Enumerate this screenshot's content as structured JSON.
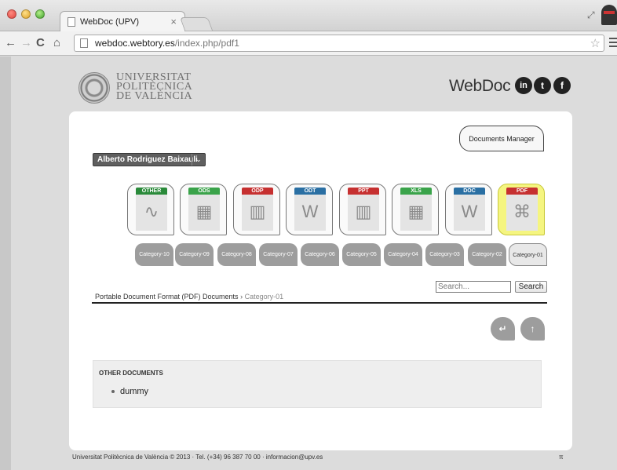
{
  "browser": {
    "tab_title": "WebDoc (UPV)",
    "tab_close": "×",
    "url_host": "webdoc.webtory.es",
    "url_path": "/index.php/pdf1",
    "back": "←",
    "forward": "→",
    "reload": "C",
    "home": "⌂",
    "star": "☆"
  },
  "header": {
    "university_lines": [
      "UNIVERSITAT",
      "POLITÈCNICA",
      "DE VALÈNCIA"
    ],
    "brand": "WebDoc",
    "social": {
      "linkedin": "in",
      "twitter": "t",
      "facebook": "f"
    }
  },
  "documents_manager_label": "Documents Manager",
  "user": {
    "name": "Alberto Rodriguez Baixauli",
    "caret": "⌄"
  },
  "types": [
    {
      "label": "OTHER",
      "color": "#2a8a3a",
      "glyph": "∿"
    },
    {
      "label": "ODS",
      "color": "#3aa34a",
      "glyph": "▦"
    },
    {
      "label": "ODP",
      "color": "#c63030",
      "glyph": "▥"
    },
    {
      "label": "ODT",
      "color": "#2a6fa3",
      "glyph": "W"
    },
    {
      "label": "PPT",
      "color": "#c63030",
      "glyph": "▥"
    },
    {
      "label": "XLS",
      "color": "#3aa34a",
      "glyph": "▦"
    },
    {
      "label": "DOC",
      "color": "#2a6fa3",
      "glyph": "W"
    },
    {
      "label": "PDF",
      "color": "#c63030",
      "glyph": "⌘"
    }
  ],
  "categories": [
    "Category-10",
    "Category-09",
    "Category-08",
    "Category-07",
    "Category-06",
    "Category-05",
    "Category-04",
    "Category-03",
    "Category-02",
    "Category-01"
  ],
  "search": {
    "placeholder": "Search...",
    "button": "Search"
  },
  "breadcrumb": {
    "section": "Portable Document Format (PDF) Documents",
    "separator": "›",
    "current": "Category-01"
  },
  "nav_buttons": {
    "return": "↵",
    "up": "↑"
  },
  "other_documents": {
    "title": "OTHER DOCUMENTS",
    "items": [
      "dummy"
    ]
  },
  "footer": {
    "text": "Universitat Politècnica de València © 2013 · Tel. (+34) 96 387 70 00 · informacion@upv.es",
    "pi": "π"
  }
}
